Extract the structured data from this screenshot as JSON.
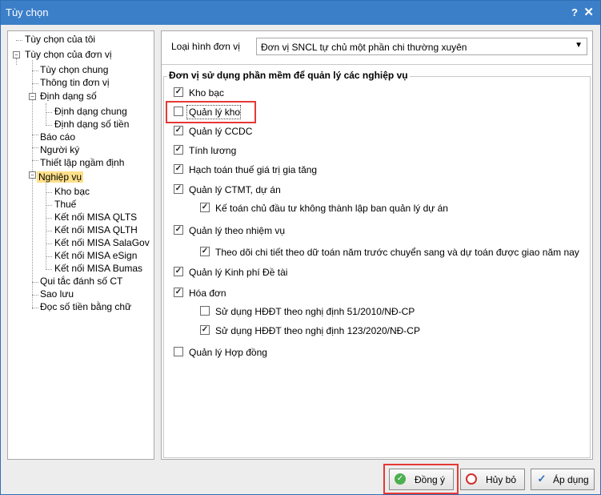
{
  "window": {
    "title": "Tùy chọn",
    "help_glyph": "?",
    "close_glyph": "✕"
  },
  "tree": {
    "items": [
      {
        "label": "Tùy chọn của tôi"
      },
      {
        "label": "Tùy chọn của đơn vị"
      },
      {
        "label": "Tùy chọn chung"
      },
      {
        "label": "Thông tin đơn vị"
      },
      {
        "label": "Định dạng số"
      },
      {
        "label": "Định dạng chung"
      },
      {
        "label": "Định dạng số tiền"
      },
      {
        "label": "Báo cáo"
      },
      {
        "label": "Người ký"
      },
      {
        "label": "Thiết lập ngầm định"
      },
      {
        "label": "Nghiệp vụ"
      },
      {
        "label": "Kho bạc"
      },
      {
        "label": "Thuế"
      },
      {
        "label": "Kết nối MISA QLTS"
      },
      {
        "label": "Kết nối MISA QLTH"
      },
      {
        "label": "Kết nối MISA SalaGov"
      },
      {
        "label": "Kết nối MISA eSign"
      },
      {
        "label": "Kết nối MISA Bumas"
      },
      {
        "label": "Qui tắc đánh số CT"
      },
      {
        "label": "Sao lưu"
      },
      {
        "label": "Đọc số tiền bằng chữ"
      }
    ]
  },
  "unit_type": {
    "label": "Loại hình đơn vị",
    "value": "Đơn vị SNCL tự chủ một phần chi thường xuyên"
  },
  "group": {
    "title": "Đơn vị sử dụng phần mềm để quản lý các nghiệp vụ"
  },
  "options": [
    {
      "label": "Kho bạc",
      "checked": true
    },
    {
      "label": "Quản lý kho",
      "checked": false
    },
    {
      "label": "Quản lý CCDC",
      "checked": true
    },
    {
      "label": "Tính lương",
      "checked": true
    },
    {
      "label": "Hạch toán thuế giá trị gia tăng",
      "checked": true
    },
    {
      "label": "Quản lý CTMT, dự án",
      "checked": true
    },
    {
      "label": "Kế toán chủ đầu tư không thành lập ban quản lý dự án",
      "checked": true
    },
    {
      "label": "Quản lý theo nhiệm vụ",
      "checked": true
    },
    {
      "label": "Theo dõi chi tiết theo dữ toán năm trước chuyển sang và dự toán được giao năm nay",
      "checked": true
    },
    {
      "label": "Quản lý Kinh phí Đề tài",
      "checked": true
    },
    {
      "label": "Hóa đơn",
      "checked": true
    },
    {
      "label": "Sử dụng HĐĐT theo nghị định 51/2010/NĐ-CP",
      "checked": false
    },
    {
      "label": "Sử dụng HĐĐT theo nghị định 123/2020/NĐ-CP",
      "checked": true
    },
    {
      "label": "Quản lý Hợp đồng",
      "checked": false
    }
  ],
  "buttons": {
    "ok": "Đồng ý",
    "cancel": "Hủy bỏ",
    "apply": "Áp dụng"
  },
  "colors": {
    "titlebar": "#3c7fc9",
    "selected": "#ffe08a",
    "highlight": "#e53935"
  }
}
